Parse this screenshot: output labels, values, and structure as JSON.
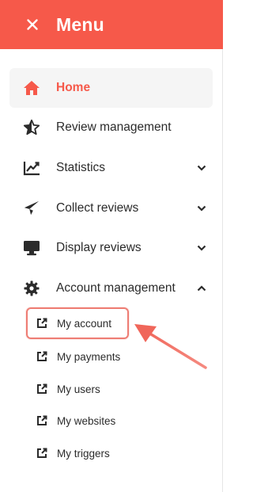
{
  "header": {
    "title": "Menu",
    "close_icon": "close-icon",
    "background": "#f6594a"
  },
  "nav": {
    "items": [
      {
        "label": "Home",
        "icon": "home-icon",
        "active": true,
        "expandable": false
      },
      {
        "label": "Review management",
        "icon": "star-icon",
        "active": false,
        "expandable": false
      },
      {
        "label": "Statistics",
        "icon": "chart-line-icon",
        "active": false,
        "expandable": true,
        "expanded": false
      },
      {
        "label": "Collect reviews",
        "icon": "paper-plane-icon",
        "active": false,
        "expandable": true,
        "expanded": false
      },
      {
        "label": "Display reviews",
        "icon": "monitor-icon",
        "active": false,
        "expandable": true,
        "expanded": false
      },
      {
        "label": "Account management",
        "icon": "gear-icon",
        "active": false,
        "expandable": true,
        "expanded": true
      }
    ],
    "account_submenu": [
      {
        "label": "My account",
        "icon": "external-link-icon",
        "highlighted": true
      },
      {
        "label": "My payments",
        "icon": "external-link-icon",
        "highlighted": false
      },
      {
        "label": "My users",
        "icon": "external-link-icon",
        "highlighted": false
      },
      {
        "label": "My websites",
        "icon": "external-link-icon",
        "highlighted": false
      },
      {
        "label": "My triggers",
        "icon": "external-link-icon",
        "highlighted": false
      }
    ]
  },
  "colors": {
    "accent": "#f6594a",
    "highlight_border": "#ee7d74",
    "active_bg": "#f5f5f5",
    "text": "#2b2b2b"
  }
}
